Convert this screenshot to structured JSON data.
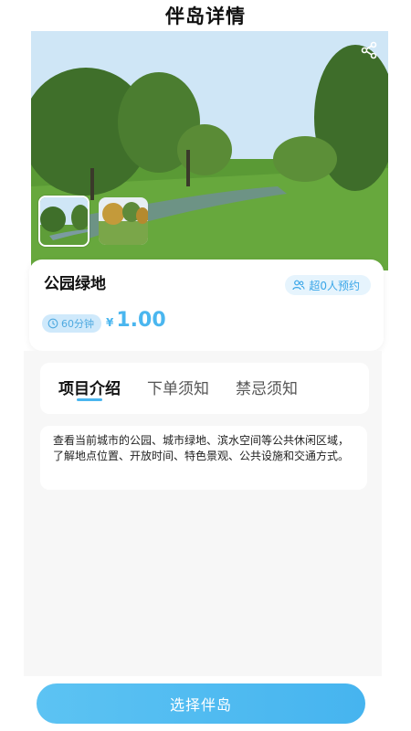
{
  "header": {
    "title": "伴岛详情"
  },
  "hero": {
    "share_icon": "share-icon",
    "thumbnail_count": 2
  },
  "info": {
    "name": "公园绿地",
    "booking_badge": "超0人预约",
    "duration_badge": "60分钟",
    "price_currency": "¥",
    "price_value": "1.00",
    "accent_color": "#4ab6ef"
  },
  "tabs": [
    {
      "label": "项目介绍",
      "active": true
    },
    {
      "label": "下单须知",
      "active": false
    },
    {
      "label": "禁忌须知",
      "active": false
    }
  ],
  "description": "查看当前城市的公园、城市绿地、滨水空间等公共休闲区域，了解地点位置、开放时间、特色景观、公共设施和交通方式。",
  "footer": {
    "cta_label": "选择伴岛"
  }
}
